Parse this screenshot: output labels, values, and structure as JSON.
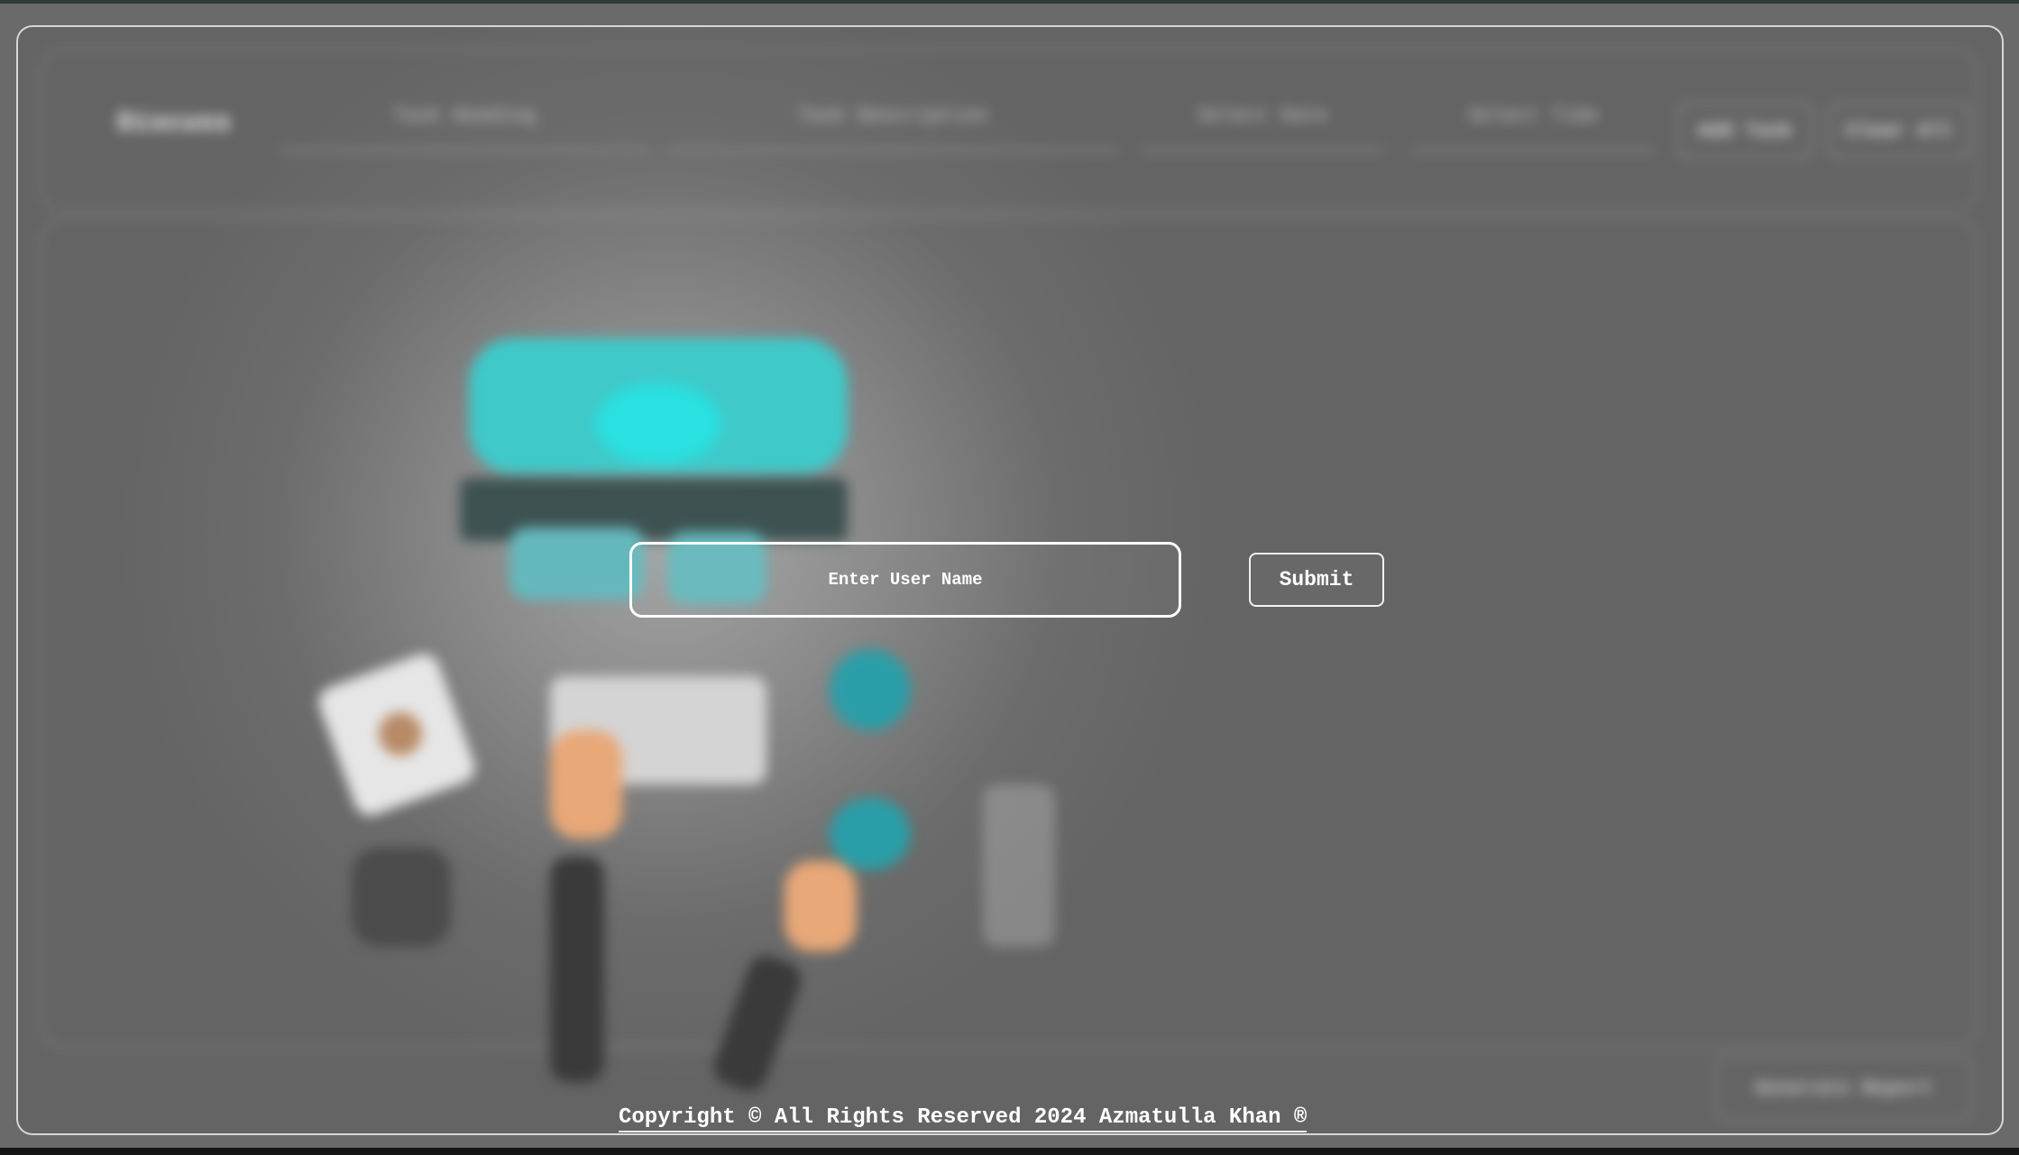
{
  "background": {
    "logo_text": "Discuss",
    "fields": [
      "Task Heading",
      "Task Description",
      "Select Date",
      "Select Time"
    ],
    "buttons": [
      "Add Task",
      "Clear All"
    ],
    "generate_button": "Generate Report"
  },
  "form": {
    "username_placeholder": "Enter User Name",
    "username_value": "",
    "submit_label": "Submit"
  },
  "footer": {
    "copyright": "Copyright © All Rights Reserved 2024 Azmatulla Khan ®"
  },
  "colors": {
    "overlay": "#6a6a6a",
    "accent_teal": "#2ae0e0",
    "foreground_text": "#ffffff"
  }
}
